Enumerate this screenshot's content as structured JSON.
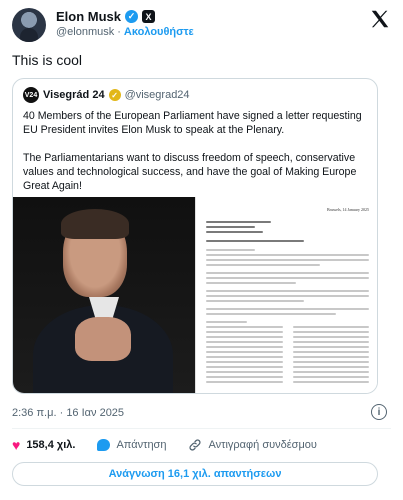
{
  "author": {
    "name": "Elon Musk",
    "handle": "@elonmusk",
    "separator": "·",
    "follow_label": "Ακολουθήστε"
  },
  "tweet": {
    "text": "This is cool"
  },
  "quoted": {
    "avatar_text": "V24",
    "name": "Visegrád 24",
    "handle": "@visegrad24",
    "paragraph1": "40 Members of the European Parliament have signed a letter requesting EU President  invites Elon Musk to speak at the Plenary.",
    "paragraph2": "The Parliamentarians want to discuss freedom of speech, conservative values and technological success, and have the goal of Making Europe Great Again!",
    "letter": {
      "date": "Brussels, 14 January 2025"
    }
  },
  "meta": {
    "time": "2:36 π.μ.",
    "separator": "·",
    "date": "16 Ιαν 2025"
  },
  "actions": {
    "likes": "158,4 χιλ.",
    "reply_label": "Απάντηση",
    "copy_link_label": "Αντιγραφή συνδέσμου"
  },
  "read_replies_label": "Ανάγνωση 16,1 χιλ. απαντήσεων",
  "colors": {
    "accent": "#1d9bf0",
    "like": "#f91880",
    "gold_badge": "#e2b719"
  }
}
